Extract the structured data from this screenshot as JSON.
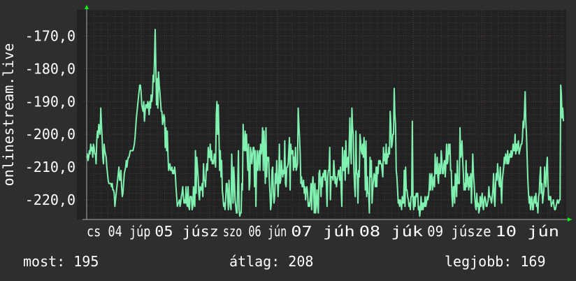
{
  "colors": {
    "background": "#2e2e2e",
    "plot_background": "#222222",
    "grid_major": "#5a3c3c",
    "grid_minor": "#3a3a3a",
    "line": "#7ff0b0",
    "axis_arrow": "#00ff00",
    "text": "#ffffff"
  },
  "stats": {
    "current": "most: 195",
    "average": "átlag: 208",
    "best": "legjobb: 169"
  },
  "chart_data": {
    "type": "line",
    "ylabel": "onlinestream.live",
    "ylim": [
      -226,
      -162
    ],
    "yticks": [
      -170,
      -180,
      -190,
      -200,
      -210,
      -220
    ],
    "ytick_labels": [
      "-170,0",
      "-180,0",
      "-190,0",
      "-200,0",
      "-210,0",
      "-220,0"
    ],
    "xlim": [
      0,
      698
    ],
    "xtick_labels": [
      "cs 04 júp",
      "05 júsz",
      "szo 06 jún",
      "07 júh",
      "08 júk",
      "09 júsze",
      "10 jún"
    ],
    "grid": true,
    "series": [
      {
        "values": [
          -207,
          -206,
          -208,
          -207,
          -205,
          -206,
          -203,
          -205,
          -204,
          -207,
          -203,
          -204,
          -206,
          -206,
          -209,
          -202,
          -199,
          -201,
          -197,
          -199,
          -200,
          -192,
          -197,
          -201,
          -207,
          -209,
          -203,
          -205,
          -206,
          -207,
          -210,
          -212,
          -214,
          -215,
          -215,
          -215,
          -215,
          -216,
          -215,
          -217,
          -217,
          -218,
          -222,
          -220,
          -218,
          -216,
          -214,
          -212,
          -210,
          -214,
          -214,
          -211,
          -216,
          -219,
          -218,
          -215,
          -212,
          -211,
          -210,
          -208,
          -210,
          -208,
          -207,
          -207,
          -206,
          -205,
          -205,
          -205,
          -205,
          -205,
          -204,
          -203,
          -201,
          -198,
          -195,
          -193,
          -191,
          -189,
          -187,
          -185,
          -185,
          -187,
          -191,
          -192,
          -193,
          -190,
          -196,
          -193,
          -191,
          -191,
          -192,
          -190,
          -191,
          -194,
          -190,
          -192,
          -188,
          -190,
          -188,
          -182,
          -184,
          -177,
          -168,
          -179,
          -191,
          -183,
          -192,
          -181,
          -185,
          -187,
          -190,
          -193,
          -193,
          -197,
          -196,
          -194,
          -195,
          -204,
          -198,
          -205,
          -199,
          -206,
          -211,
          -210,
          -209,
          -211,
          -211,
          -210,
          -212,
          -211,
          -212,
          -210,
          -212,
          -216,
          -219,
          -222,
          -221,
          -221,
          -220,
          -222,
          -221,
          -219,
          -218,
          -216,
          -219,
          -221,
          -220,
          -221,
          -216,
          -221,
          -222,
          -216,
          -222,
          -223,
          -219,
          -219,
          -219,
          -223,
          -222,
          -216,
          -221,
          -222,
          -205,
          -218,
          -207,
          -210,
          -213,
          -218,
          -220,
          -216,
          -217,
          -217,
          -215,
          -219,
          -209,
          -214,
          -214,
          -216,
          -211,
          -209,
          -211,
          -204,
          -207,
          -207,
          -203,
          -208,
          -205,
          -209,
          -208,
          -209,
          -206,
          -207,
          -210,
          -194,
          -190,
          -200,
          -191,
          -200,
          -211,
          -205,
          -213,
          -208,
          -217,
          -219,
          -222,
          -221,
          -223,
          -220,
          -215,
          -215,
          -219,
          -223,
          -214,
          -220,
          -222,
          -223,
          -206,
          -213,
          -221,
          -210,
          -214,
          -220,
          -222,
          -224,
          -224,
          -215,
          -205,
          -223,
          -225,
          -224,
          -224,
          -215,
          -217,
          -197,
          -204,
          -205,
          -199,
          -205,
          -200,
          -206,
          -211,
          -203,
          -217,
          -215,
          -204,
          -206,
          -209,
          -206,
          -204,
          -204,
          -216,
          -205,
          -222,
          -210,
          -205,
          -211,
          -207,
          -205,
          -211,
          -203,
          -206,
          -204,
          -198,
          -211,
          -199,
          -205,
          -215,
          -198,
          -213,
          -207,
          -208,
          -207,
          -214,
          -218,
          -223,
          -221,
          -211,
          -210,
          -218,
          -221,
          -219,
          -212,
          -215,
          -208,
          -213,
          -219,
          -214,
          -203,
          -215,
          -214,
          -208,
          -211,
          -213,
          -211,
          -212,
          -202,
          -215,
          -216,
          -210,
          -210,
          -209,
          -205,
          -201,
          -217,
          -203,
          -206,
          -205,
          -205,
          -211,
          -207,
          -210,
          -204,
          -211,
          -210,
          -209,
          -192,
          -197,
          -201,
          -206,
          -215,
          -213,
          -216,
          -216,
          -214,
          -218,
          -216,
          -220,
          -217,
          -216,
          -218,
          -222,
          -221,
          -222,
          -219,
          -215,
          -223,
          -216,
          -213,
          -217,
          -224,
          -215,
          -224,
          -221,
          -217,
          -222,
          -224,
          -212,
          -211,
          -215,
          -219,
          -213,
          -216,
          -212,
          -213,
          -211,
          -214,
          -211,
          -216,
          -222,
          -213,
          -211,
          -211,
          -204,
          -220,
          -213,
          -213,
          -213,
          -214,
          -208,
          -211,
          -215,
          -213,
          -216,
          -214,
          -213,
          -211,
          -211,
          -214,
          -210,
          -217,
          -222,
          -204,
          -211,
          -211,
          -205,
          -214,
          -202,
          -210,
          -208,
          -207,
          -212,
          -203,
          -195,
          -205,
          -209,
          -192,
          -198,
          -200,
          -211,
          -216,
          -219,
          -199,
          -212,
          -212,
          -221,
          -211,
          -213,
          -200,
          -202,
          -205,
          -206,
          -203,
          -207,
          -201,
          -205,
          -217,
          -202,
          -219,
          -213,
          -218,
          -218,
          -224,
          -207,
          -213,
          -208,
          -221,
          -217,
          -214,
          -212,
          -213,
          -216,
          -210,
          -216,
          -210,
          -212,
          -208,
          -209,
          -208,
          -209,
          -209,
          -211,
          -213,
          -204,
          -208,
          -206,
          -209,
          -203,
          -209,
          -206,
          -207,
          -204,
          -206,
          -193,
          -197,
          -204,
          -203,
          -200,
          -200,
          -186,
          -194,
          -197,
          -211,
          -213,
          -217,
          -221,
          -220,
          -222,
          -220,
          -221,
          -223,
          -219,
          -221,
          -221,
          -211,
          -222,
          -210,
          -217,
          -217,
          -219,
          -220,
          -222,
          -221,
          -223,
          -219,
          -219,
          -196,
          -220,
          -223,
          -219,
          -222,
          -219,
          -218,
          -219,
          -218,
          -223,
          -222,
          -225,
          -223,
          -219,
          -223,
          -221,
          -223,
          -221,
          -222,
          -219,
          -222,
          -221,
          -219,
          -220,
          -219,
          -217,
          -212,
          -217,
          -213,
          -212,
          -217,
          -215,
          -213,
          -216,
          -206,
          -212,
          -212,
          -207,
          -213,
          -215,
          -209,
          -212,
          -212,
          -205,
          -208,
          -212,
          -212,
          -209,
          -208,
          -213,
          -209,
          -203,
          -209,
          -208,
          -203,
          -206,
          -203,
          -211,
          -211,
          -219,
          -222,
          -216,
          -216,
          -221,
          -212,
          -213,
          -219,
          -208,
          -215,
          -215,
          -215,
          -198,
          -207,
          -206,
          -202,
          -208,
          -212,
          -217,
          -215,
          -217,
          -208,
          -216,
          -212,
          -214,
          -217,
          -213,
          -216,
          -212,
          -221,
          -214,
          -206,
          -212,
          -215,
          -219,
          -222,
          -223,
          -218,
          -222,
          -221,
          -224,
          -223,
          -219,
          -222,
          -220,
          -218,
          -222,
          -223,
          -220,
          -219,
          -220,
          -222,
          -222,
          -221,
          -220,
          -216,
          -219,
          -219,
          -220,
          -221,
          -219,
          -217,
          -212,
          -220,
          -222,
          -215,
          -212,
          -214,
          -209,
          -212,
          -215,
          -216,
          -210,
          -216,
          -221,
          -214,
          -212,
          -210,
          -207,
          -209,
          -206,
          -207,
          -209,
          -205,
          -209,
          -208,
          -206,
          -207,
          -205,
          -207,
          -206,
          -203,
          -205,
          -205,
          -200,
          -206,
          -203,
          -205,
          -203,
          -202,
          -206,
          -205,
          -204,
          -203,
          -203,
          -201,
          -196,
          -198,
          -193,
          -187,
          -196,
          -200,
          -207,
          -214,
          -218,
          -221,
          -219,
          -223,
          -220,
          -219,
          -223,
          -223,
          -220,
          -219,
          -221,
          -218,
          -222,
          -221,
          -224,
          -219,
          -218,
          -213,
          -210,
          -218,
          -215,
          -221,
          -219,
          -217,
          -210,
          -214,
          -216,
          -210,
          -207,
          -215,
          -220,
          -219,
          -220,
          -219,
          -222,
          -221,
          -221,
          -220,
          -222,
          -223,
          -223,
          -222,
          -221,
          -220,
          -221,
          -221,
          -220,
          -220,
          -185,
          -188,
          -195,
          -192,
          -196
        ]
      }
    ]
  }
}
